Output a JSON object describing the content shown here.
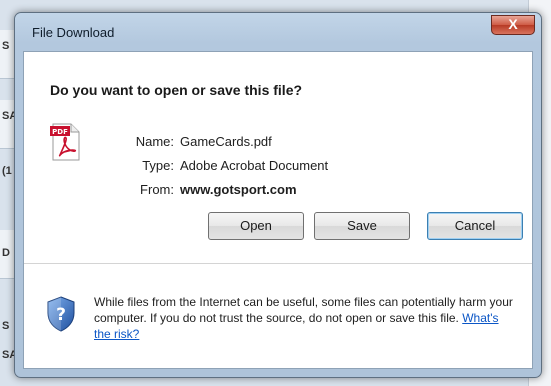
{
  "window": {
    "title": "File Download",
    "close_label": "X"
  },
  "dialog": {
    "question": "Do you want to open or save this file?",
    "file": {
      "icon": "pdf-file-icon",
      "icon_text": "PDF",
      "name_label": "Name:",
      "name_value": "GameCards.pdf",
      "type_label": "Type:",
      "type_value": "Adobe Acrobat Document",
      "from_label": "From:",
      "from_value": "www.gotsport.com"
    },
    "buttons": {
      "open": "Open",
      "save": "Save",
      "cancel": "Cancel"
    },
    "warning": {
      "icon": "shield-question-icon",
      "text": "While files from the Internet can be useful, some files can potentially harm your computer. If you do not trust the source, do not open or save this file.",
      "link": "What's the risk?"
    }
  },
  "background": {
    "fragments": [
      "S",
      "SA",
      "(1",
      "D",
      "S",
      "SA"
    ]
  },
  "colors": {
    "link": "#0b56c6",
    "pdf_red": "#c8102e",
    "shield_blue": "#2a5db0"
  }
}
